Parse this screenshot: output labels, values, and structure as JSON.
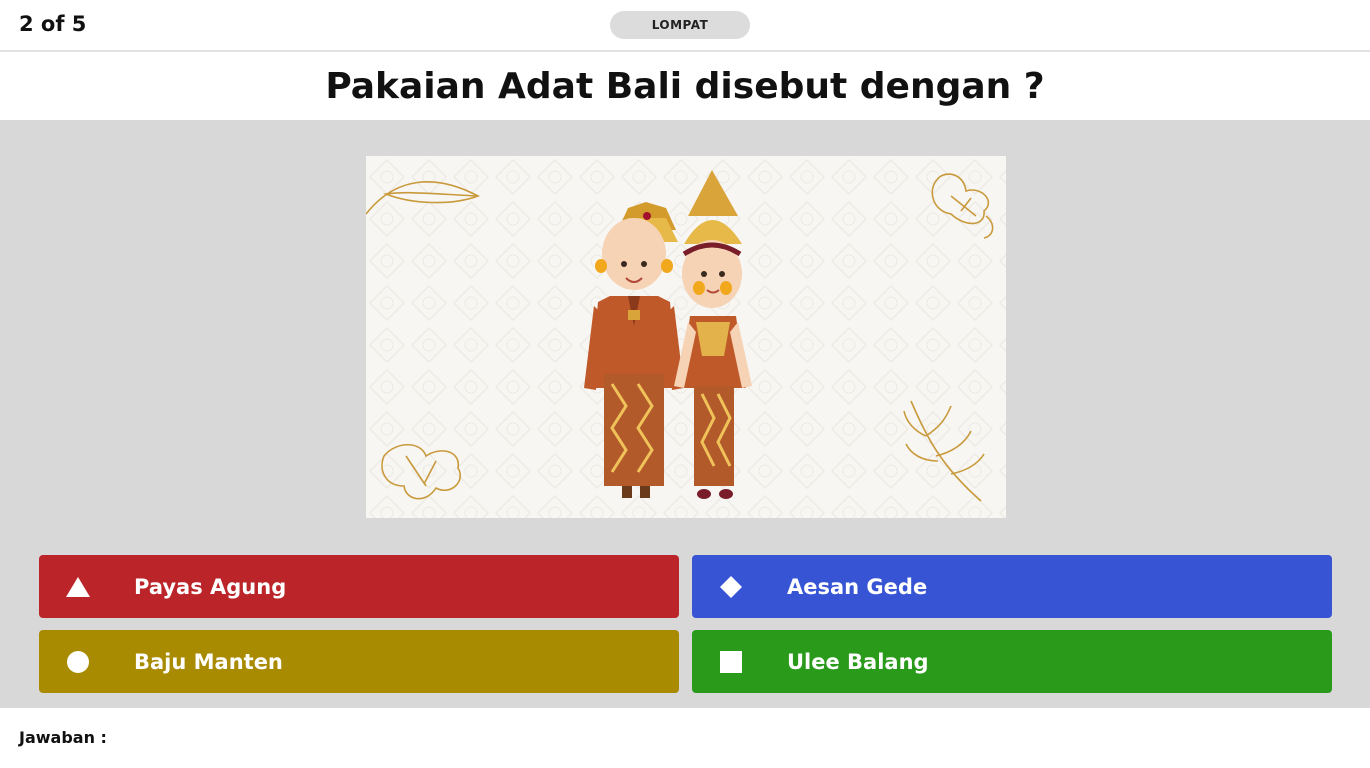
{
  "header": {
    "counter": "2 of 5",
    "skip_label": "LOMPAT"
  },
  "question": {
    "text": "Pakaian Adat Bali disebut dengan ?"
  },
  "answers": [
    {
      "label": "Payas Agung",
      "icon": "triangle-icon",
      "color": "#bb2428"
    },
    {
      "label": "Aesan Gede",
      "icon": "diamond-icon",
      "color": "#3654d3"
    },
    {
      "label": "Baju Manten",
      "icon": "circle-icon",
      "color": "#a98b02"
    },
    {
      "label": "Ulee Balang",
      "icon": "square-icon",
      "color": "#2a9a1b"
    }
  ],
  "footer": {
    "label": "Jawaban :"
  }
}
